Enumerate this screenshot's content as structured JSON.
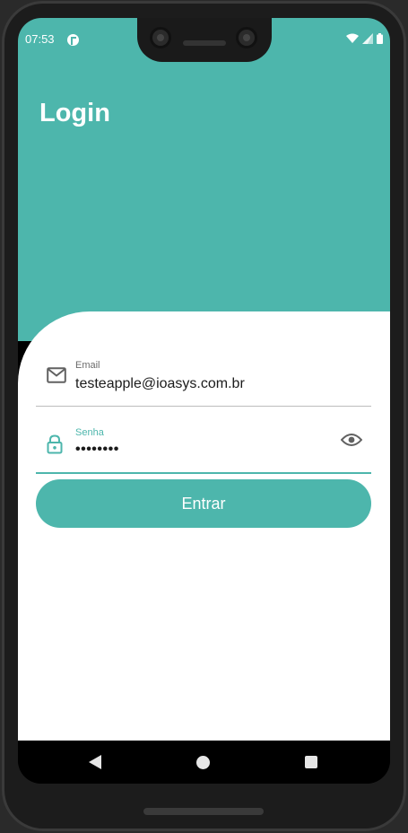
{
  "status_bar": {
    "time": "07:53",
    "icons": [
      "app-notification-icon",
      "wifi-icon",
      "signal-icon",
      "battery-icon"
    ]
  },
  "header": {
    "title": "Login"
  },
  "form": {
    "email": {
      "label": "Email",
      "value": "testeapple@ioasys.com.br",
      "icon": "mail-icon"
    },
    "password": {
      "label": "Senha",
      "value": "••••••••",
      "icon": "lock-icon",
      "toggle_icon": "eye-icon"
    },
    "submit_label": "Entrar"
  },
  "navigation": {
    "icons": [
      "back-icon",
      "home-icon",
      "recent-apps-icon"
    ]
  },
  "colors": {
    "accent": "#4db6ac",
    "card": "#ffffff",
    "text": "#1b1b1b",
    "label": "#6b6b6b",
    "underline": "#bdbdbd"
  }
}
